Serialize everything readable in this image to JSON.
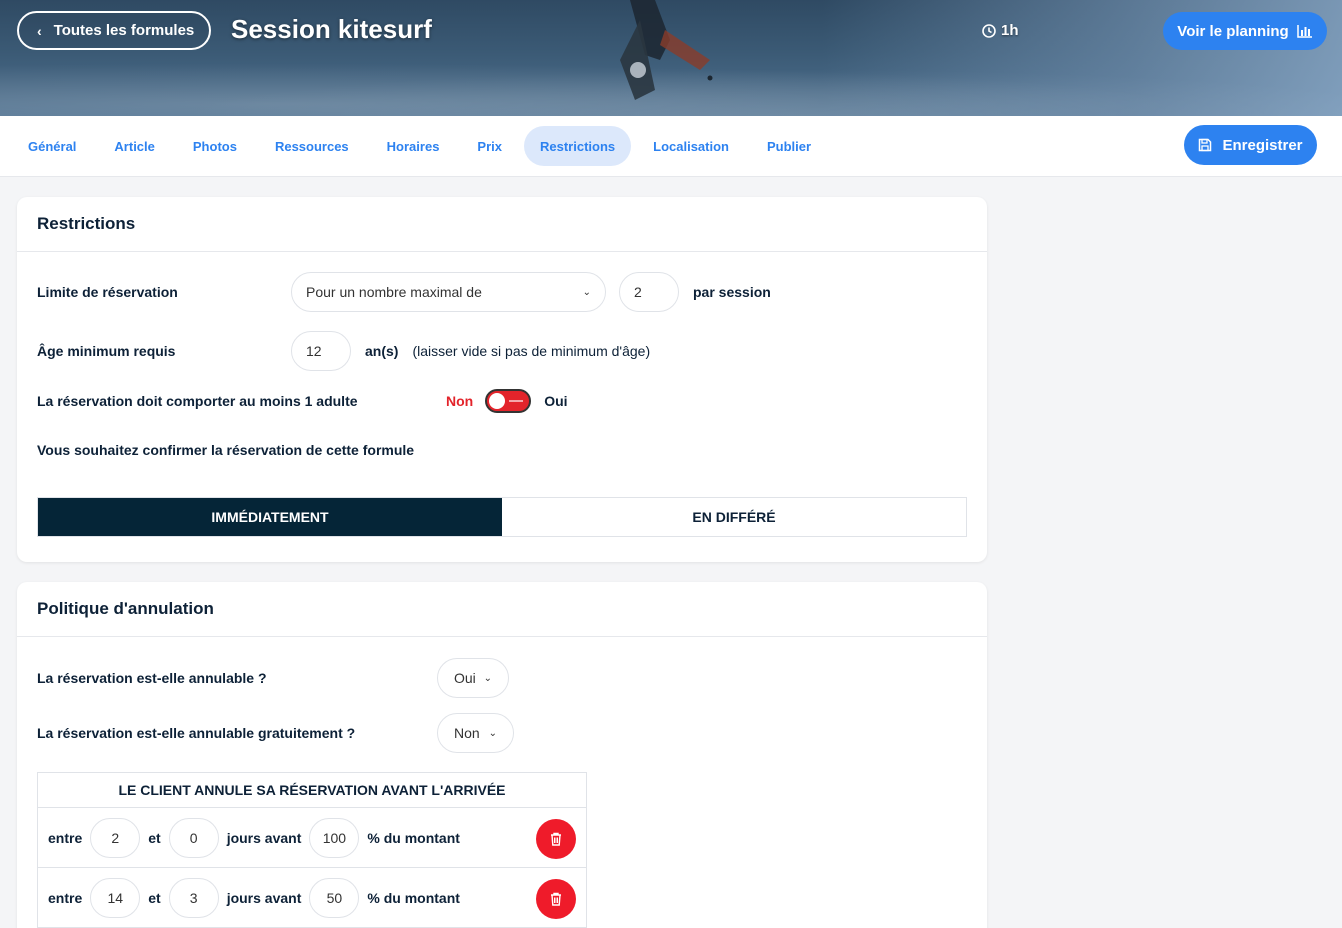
{
  "header": {
    "back_label": "Toutes les formules",
    "title": "Session kitesurf",
    "duration": "1h",
    "planning_label": "Voir le planning"
  },
  "tabs": [
    {
      "label": "Général"
    },
    {
      "label": "Article"
    },
    {
      "label": "Photos"
    },
    {
      "label": "Ressources"
    },
    {
      "label": "Horaires"
    },
    {
      "label": "Prix"
    },
    {
      "label": "Restrictions",
      "active": true
    },
    {
      "label": "Localisation"
    },
    {
      "label": "Publier"
    }
  ],
  "save_label": "Enregistrer",
  "restrictions": {
    "title": "Restrictions",
    "limit_label": "Limite de réservation",
    "limit_select": "Pour un nombre maximal de",
    "limit_value": "2",
    "limit_suffix": "par session",
    "age_label": "Âge minimum requis",
    "age_value": "12",
    "age_unit": "an(s)",
    "age_hint": "(laisser vide si pas de minimum d'âge)",
    "adult_label": "La réservation doit comporter au moins 1 adulte",
    "adult_no": "Non",
    "adult_yes": "Oui",
    "confirm_label": "Vous souhaitez confirmer la réservation de cette formule",
    "confirm_now": "IMMÉDIATEMENT",
    "confirm_later": "EN DIFFÉRÉ"
  },
  "cancellation": {
    "title": "Politique d'annulation",
    "cancellable_label": "La réservation est-elle annulable ?",
    "cancellable_value": "Oui",
    "free_label": "La réservation est-elle annulable gratuitement ?",
    "free_value": "Non",
    "table_header": "LE CLIENT ANNULE SA RÉSERVATION AVANT L'ARRIVÉE",
    "rows": [
      {
        "between": "entre",
        "from": "2",
        "and": "et",
        "to": "0",
        "days": "jours avant",
        "percent": "100",
        "suffix": "% du montant"
      },
      {
        "between": "entre",
        "from": "14",
        "and": "et",
        "to": "3",
        "days": "jours avant",
        "percent": "50",
        "suffix": "% du montant"
      }
    ]
  },
  "colors": {
    "accent": "#2d82f0",
    "danger": "#ef1b2a",
    "dark": "#052537"
  }
}
